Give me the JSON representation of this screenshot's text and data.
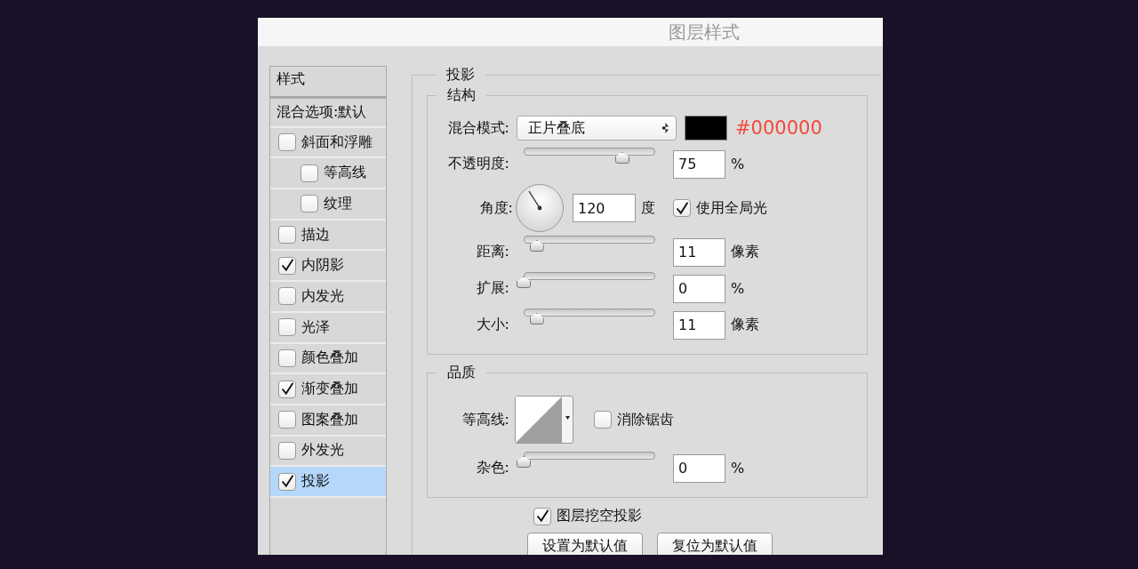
{
  "window": {
    "title": "图层样式"
  },
  "sidebar": {
    "header": "样式",
    "blend_options": "混合选项:默认",
    "items": [
      {
        "label": "斜面和浮雕",
        "checked": false,
        "selected": false,
        "children": [
          {
            "label": "等高线",
            "checked": false,
            "selected": false
          },
          {
            "label": "纹理",
            "checked": false,
            "selected": false
          }
        ]
      },
      {
        "label": "描边",
        "checked": false,
        "selected": false
      },
      {
        "label": "内阴影",
        "checked": true,
        "selected": false
      },
      {
        "label": "内发光",
        "checked": false,
        "selected": false
      },
      {
        "label": "光泽",
        "checked": false,
        "selected": false
      },
      {
        "label": "颜色叠加",
        "checked": false,
        "selected": false
      },
      {
        "label": "渐变叠加",
        "checked": true,
        "selected": false
      },
      {
        "label": "图案叠加",
        "checked": false,
        "selected": false
      },
      {
        "label": "外发光",
        "checked": false,
        "selected": false
      },
      {
        "label": "投影",
        "checked": true,
        "selected": true
      }
    ]
  },
  "panel": {
    "title": "投影",
    "structure": {
      "title": "结构",
      "blend_mode": {
        "label": "混合模式:",
        "value": "正片叠底",
        "color": "#000000",
        "hex": "#000000"
      },
      "rows": [
        {
          "kind": "slider",
          "label": "不透明度:",
          "level": 0.75,
          "value": "75",
          "unit": "%"
        },
        {
          "kind": "angle",
          "label": "角度:",
          "value": "120",
          "unit": "度",
          "global_light": {
            "label": "使用全局光",
            "checked": true
          }
        },
        {
          "kind": "slider",
          "label": "距离:",
          "level": 0.1,
          "value": "11",
          "unit": "像素"
        },
        {
          "kind": "slider",
          "label": "扩展:",
          "level": 0,
          "value": "0",
          "unit": "%"
        },
        {
          "kind": "slider",
          "label": "大小:",
          "level": 0.1,
          "value": "11",
          "unit": "像素"
        }
      ]
    },
    "quality": {
      "title": "品质",
      "contour": {
        "label": "等高线:"
      },
      "anti_alias": {
        "label": "消除锯齿",
        "checked": false
      },
      "rows": [
        {
          "kind": "slider",
          "label": "杂色:",
          "level": 0,
          "value": "0",
          "unit": "%"
        }
      ]
    },
    "knockout": {
      "label": "图层挖空投影",
      "checked": true
    },
    "buttons": [
      "设置为默认值",
      "复位为默认值"
    ]
  }
}
